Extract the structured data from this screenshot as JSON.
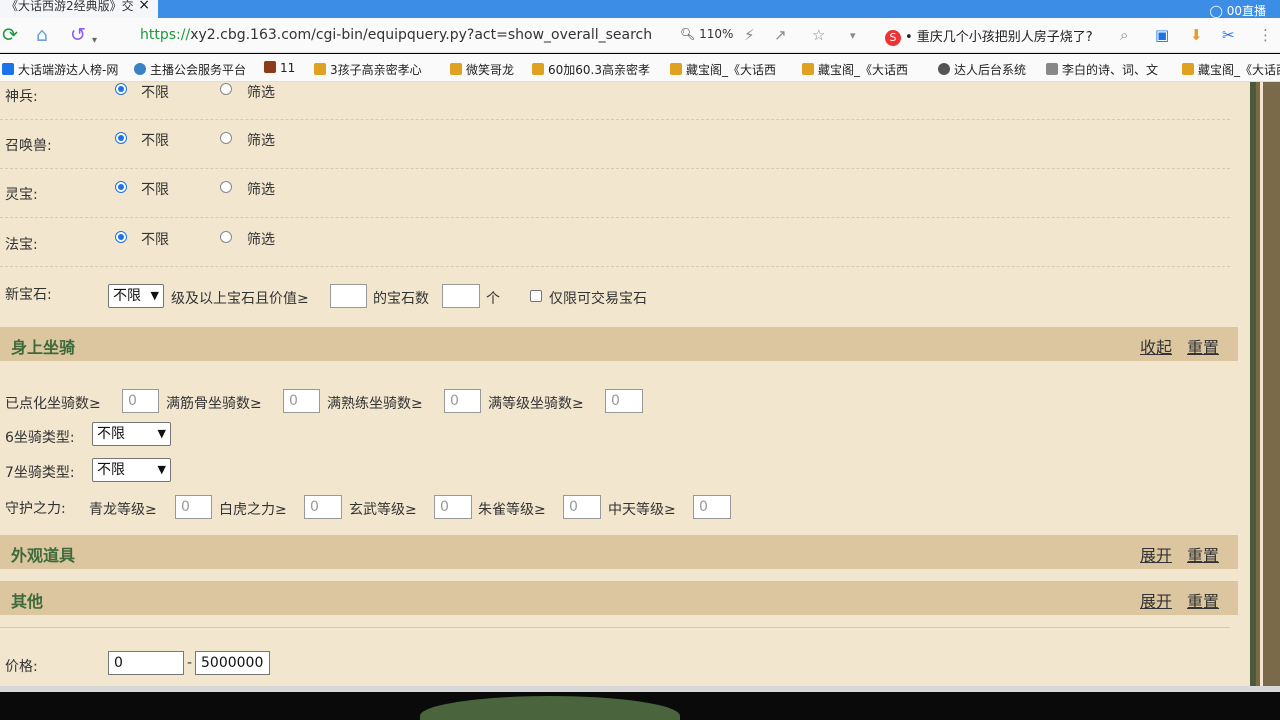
{
  "browser": {
    "tab_title": "《大话西游2经典版》交",
    "tab_close": "×",
    "tab_right": "◯ 00直播",
    "url_proto": "https://",
    "url_rest": "xy2.cbg.163.com/cgi-bin/equipquery.py?act=show_overall_search",
    "zoom": "110%",
    "news_logo": "S",
    "news": "• 重庆几个小孩把别人房子烧了?",
    "bookmarks": [
      {
        "label": "大话端游达人榜-网",
        "color": "#1a73e8"
      },
      {
        "label": "主播公会服务平台",
        "color": "#3b82c4"
      },
      {
        "label": "11",
        "color": "#8b3a1a"
      },
      {
        "label": "3孩子高亲密孝心",
        "color": "#e0a020"
      },
      {
        "label": "微笑哥龙",
        "color": "#e0a020"
      },
      {
        "label": "60加60.3高亲密孝",
        "color": "#e0a020"
      },
      {
        "label": "藏宝阁_《大话西",
        "color": "#e0a020"
      },
      {
        "label": "藏宝阁_《大话西",
        "color": "#e0a020"
      },
      {
        "label": "达人后台系统",
        "color": "#555555"
      },
      {
        "label": "李白的诗、词、文",
        "color": "#888888"
      },
      {
        "label": "藏宝阁_《大话西",
        "color": "#e0a020"
      }
    ]
  },
  "filters": {
    "rows": [
      {
        "label": "神兵:",
        "opt1": "不限",
        "opt2": "筛选"
      },
      {
        "label": "召唤兽:",
        "opt1": "不限",
        "opt2": "筛选"
      },
      {
        "label": "灵宝:",
        "opt1": "不限",
        "opt2": "筛选"
      },
      {
        "label": "法宝:",
        "opt1": "不限",
        "opt2": "筛选"
      }
    ],
    "gem": {
      "label": "新宝石:",
      "select": "不限",
      "text1": "级及以上宝石且价值≥",
      "text2": "的宝石数",
      "text3": "个",
      "checkbox_label": "仅限可交易宝石"
    }
  },
  "mount_section": {
    "title": "身上坐骑",
    "collapse": "收起",
    "reset": "重置",
    "stats": [
      {
        "label": "已点化坐骑数≥",
        "value": "0"
      },
      {
        "label": "满筋骨坐骑数≥",
        "value": "0"
      },
      {
        "label": "满熟练坐骑数≥",
        "value": "0"
      },
      {
        "label": "满等级坐骑数≥",
        "value": "0"
      }
    ],
    "type6_label": "6坐骑类型:",
    "type6_value": "不限",
    "type7_label": "7坐骑类型:",
    "type7_value": "不限",
    "guard_label": "守护之力:",
    "guards": [
      {
        "label": "青龙等级≥",
        "value": "0"
      },
      {
        "label": "白虎之力≥",
        "value": "0"
      },
      {
        "label": "玄武等级≥",
        "value": "0"
      },
      {
        "label": "朱雀等级≥",
        "value": "0"
      },
      {
        "label": "中天等级≥",
        "value": "0"
      }
    ]
  },
  "appearance_section": {
    "title": "外观道具",
    "expand": "展开",
    "reset": "重置"
  },
  "other_section": {
    "title": "其他",
    "expand": "展开",
    "reset": "重置"
  },
  "price": {
    "label": "价格:",
    "min": "0",
    "sep": "-",
    "max": "5000000"
  }
}
